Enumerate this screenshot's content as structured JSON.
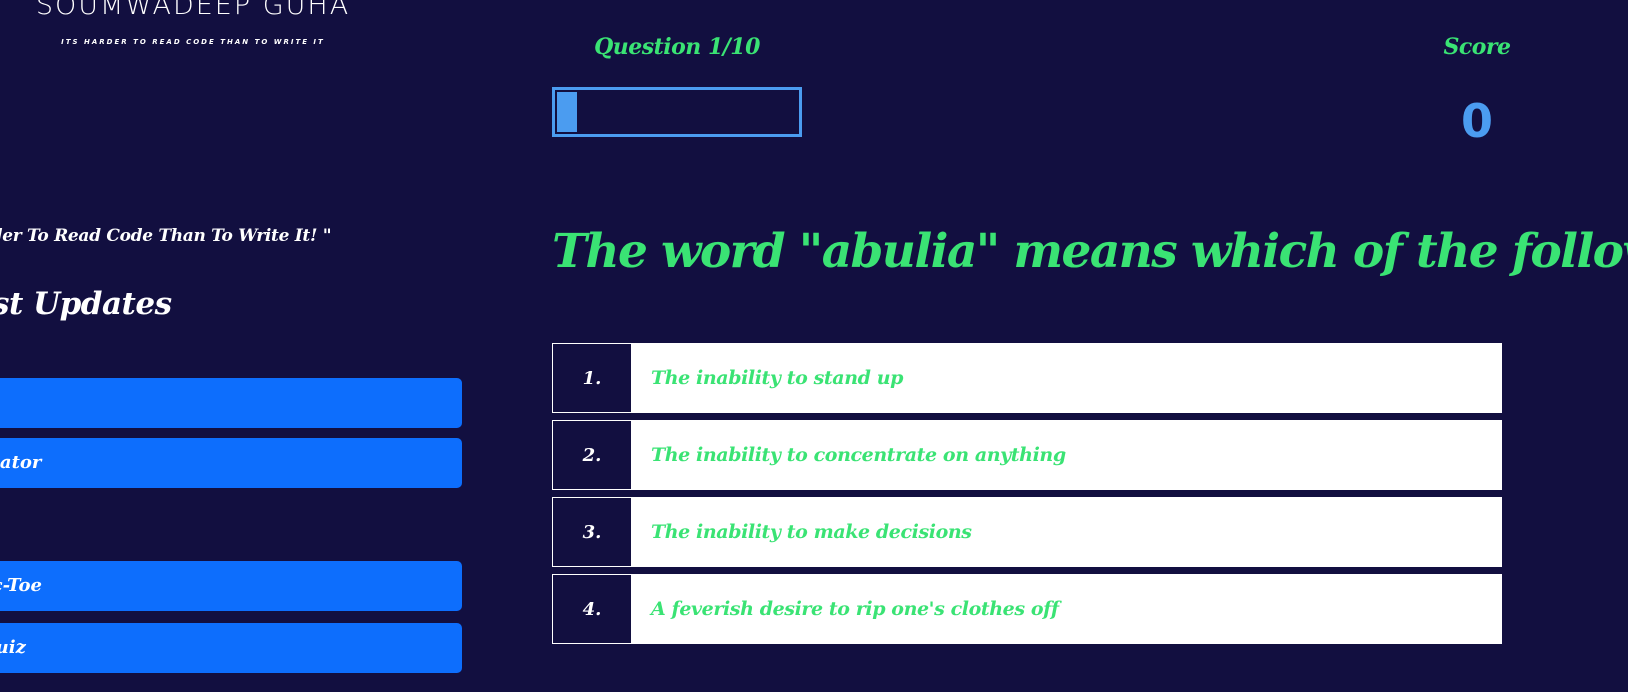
{
  "brand": {
    "name": "SOUMWADEEP  GUHA",
    "tagline": "ITS HARDER TO READ CODE THAN TO WRITE IT"
  },
  "sidebar": {
    "quote": "rder To Read Code Than To Write It! \"",
    "updates_title": "st Updates",
    "buttons": [
      {
        "label": ""
      },
      {
        "label": "ulator"
      },
      {
        "label": "ac-Toe"
      },
      {
        "label": "Quiz"
      }
    ]
  },
  "quiz": {
    "counter": "Question 1/10",
    "progress_fraction": 0.1,
    "score_label": "Score",
    "score_value": "0",
    "question": "The word \"abulia\" means which of the following?",
    "options": [
      {
        "num": "1.",
        "text": "The inability to stand up"
      },
      {
        "num": "2.",
        "text": "The inability to concentrate on anything"
      },
      {
        "num": "3.",
        "text": "The inability to make decisions"
      },
      {
        "num": "4.",
        "text": "A feverish desire to rip one's clothes off"
      }
    ]
  },
  "colors": {
    "background": "#120f40",
    "accent_green": "#3ae374",
    "accent_blue": "#4b9cf0",
    "button_blue": "#0d6efd",
    "text_white": "#ffffff"
  }
}
